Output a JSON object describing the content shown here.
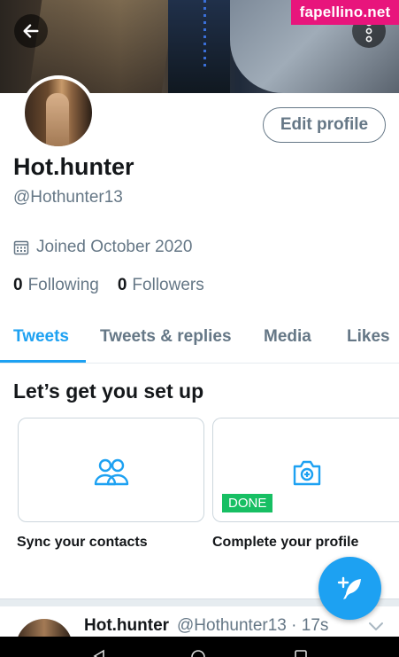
{
  "watermark": "fapellino.net",
  "header": {
    "back_icon": "arrow-left-icon",
    "more_icon": "vertical-dots-icon"
  },
  "profile": {
    "display_name": "Hot.hunter",
    "handle": "@Hothunter13",
    "edit_label": "Edit profile",
    "joined": "Joined October 2020",
    "joined_icon": "calendar-icon",
    "following_count": "0",
    "following_label": "Following",
    "followers_count": "0",
    "followers_label": "Followers"
  },
  "tabs": [
    {
      "label": "Tweets",
      "active": true
    },
    {
      "label": "Tweets & replies",
      "active": false
    },
    {
      "label": "Media",
      "active": false
    },
    {
      "label": "Likes",
      "active": false
    }
  ],
  "setup": {
    "title": "Let’s get you set up",
    "cards": [
      {
        "label": "Sync your contacts",
        "icon": "people-icon"
      },
      {
        "label": "Complete your profile",
        "icon": "camera-plus-icon",
        "badge": "DONE"
      }
    ]
  },
  "tweet": {
    "name": "Hot.hunter",
    "handle_time": "@Hothunter13 · 17s",
    "chevron_icon": "chevron-down-icon"
  },
  "fab": {
    "icon": "compose-feather-icon"
  },
  "colors": {
    "accent": "#1da1f2",
    "secondary_text": "#657786",
    "done_green": "#17bf63",
    "watermark_pink": "#e8157c"
  }
}
